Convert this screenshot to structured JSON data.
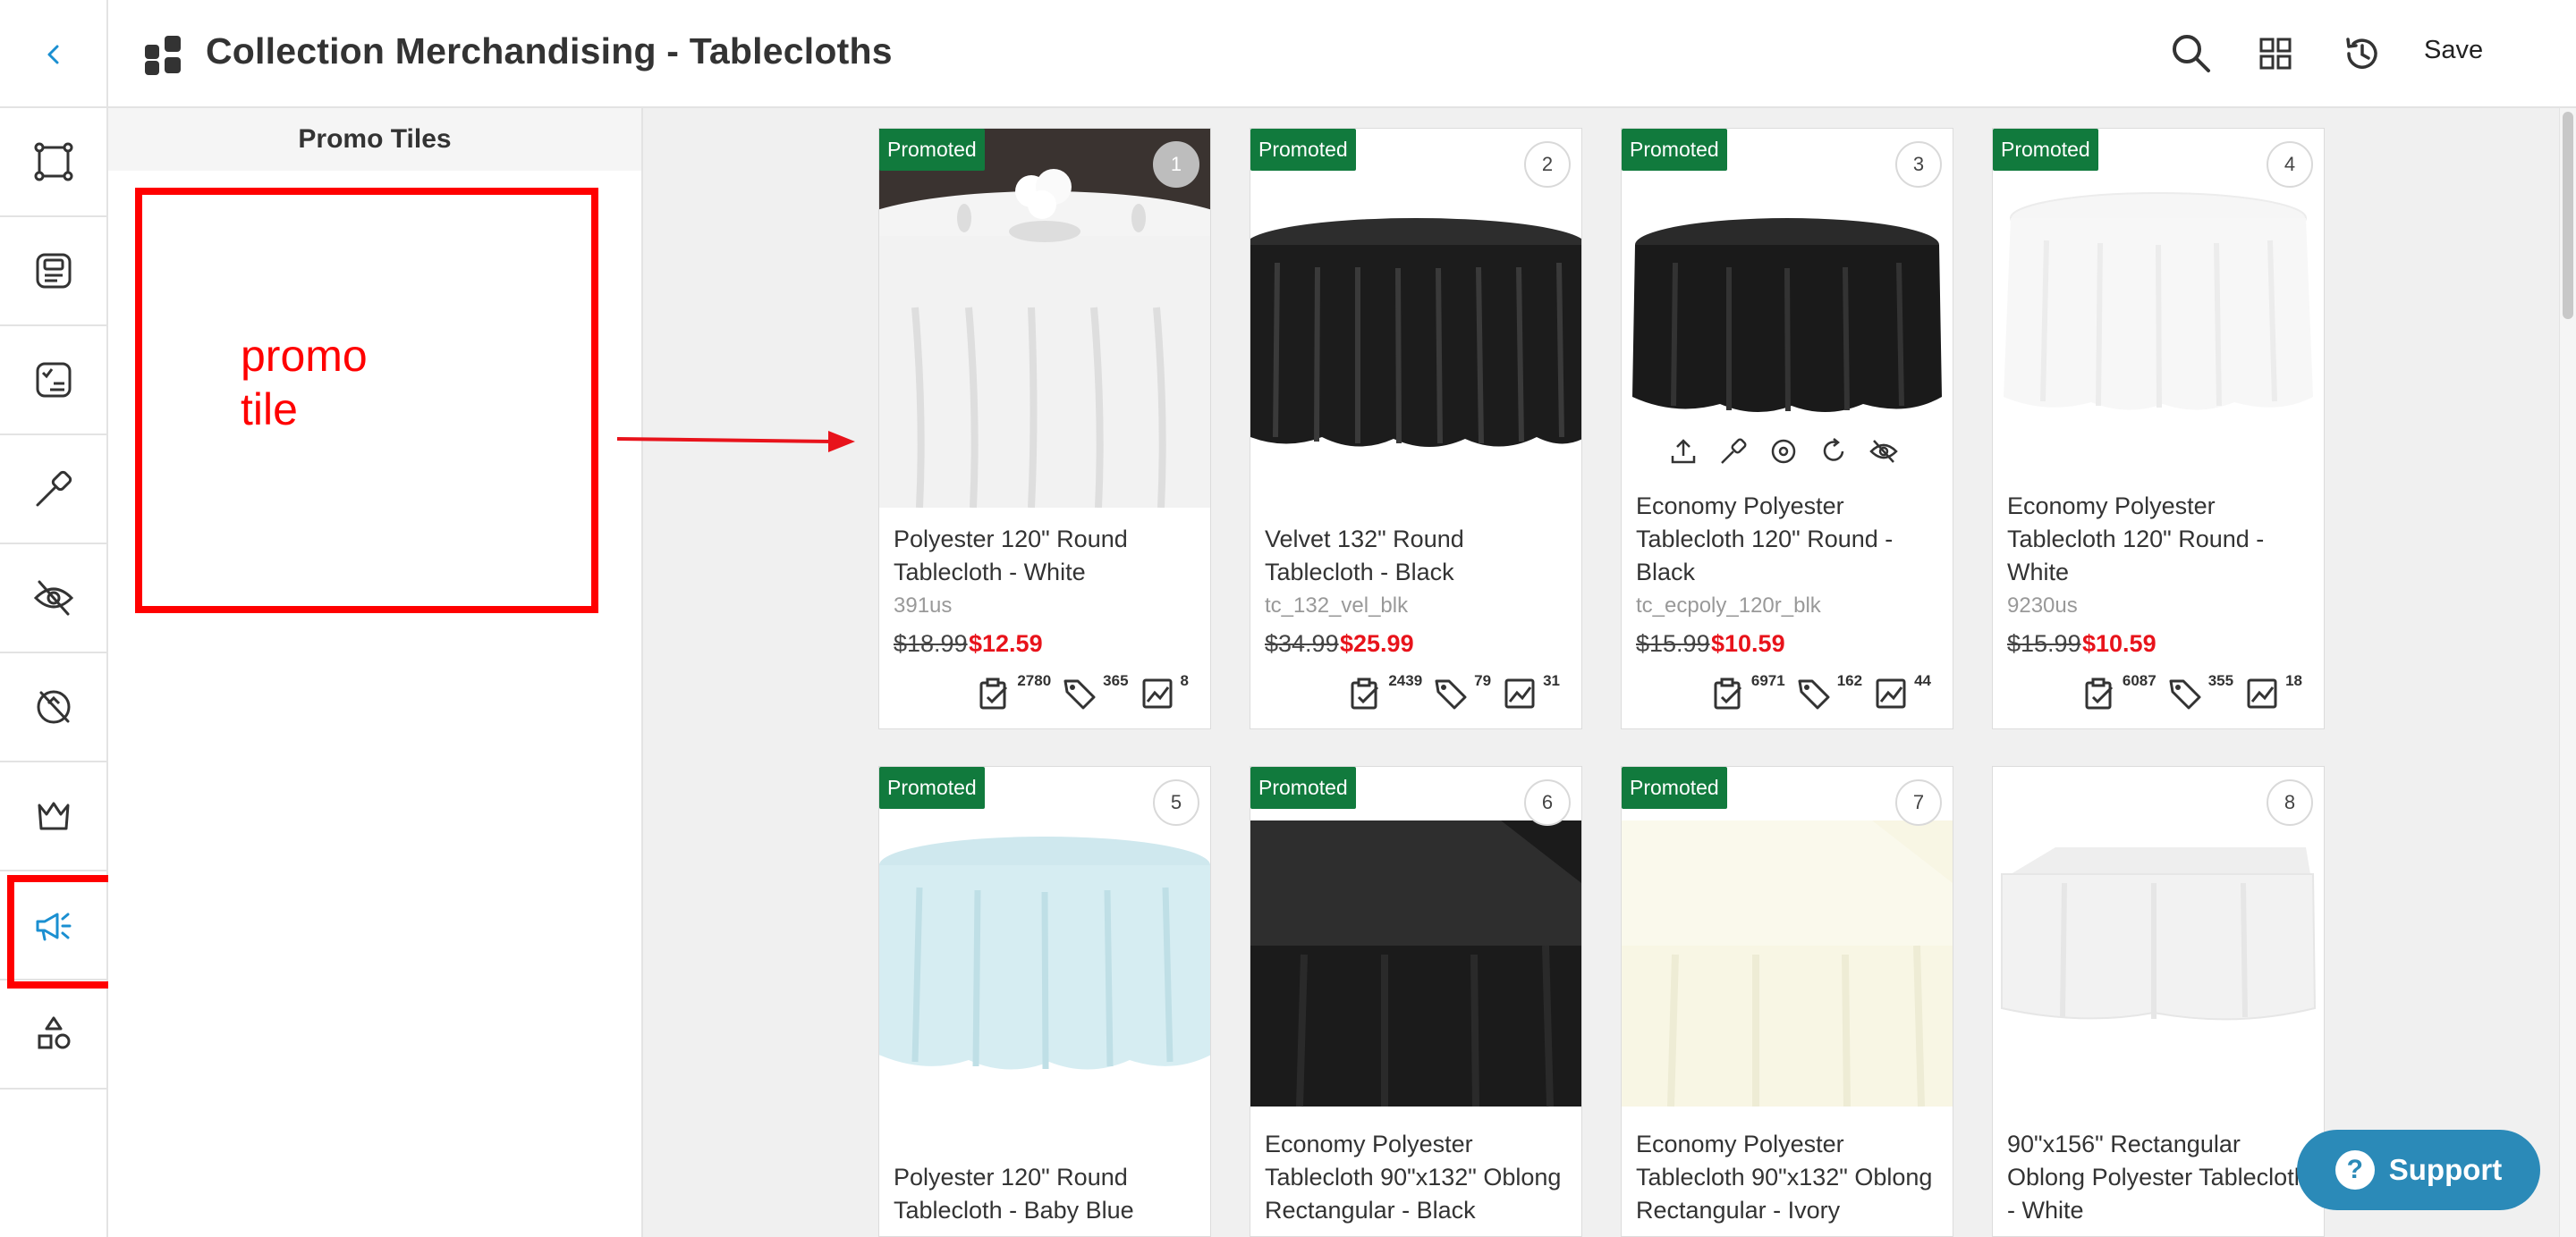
{
  "header": {
    "title": "Collection Merchandising - Tablecloths",
    "save_label": "Save",
    "icons": [
      "search-icon",
      "grid-view-icon",
      "history-icon"
    ]
  },
  "rail": {
    "items": [
      "frame-icon",
      "product-card-icon",
      "rules-icon",
      "pin-icon",
      "hide-icon",
      "exclude-icon",
      "crown-icon",
      "promo-megaphone-icon",
      "shapes-icon"
    ],
    "active": "promo-megaphone-icon",
    "accent": "#1a8fd1"
  },
  "promo": {
    "heading": "Promo Tiles",
    "annotation_line1": "promo",
    "annotation_line2": "tile"
  },
  "colors": {
    "promoted": "#117a3d",
    "sale": "#e8131b",
    "annotation": "#ff0000"
  },
  "products": [
    {
      "badge": "Promoted",
      "position": "1",
      "name_line1": "Polyester 120\" Round",
      "name_line2": "Tablecloth - White",
      "name_line3": "",
      "sku": "391us",
      "price_old": "$18.99",
      "price_new": "$12.59",
      "stat1": "2780",
      "stat2": "365",
      "stat3": "8"
    },
    {
      "badge": "Promoted",
      "position": "2",
      "name_line1": "Velvet 132\" Round",
      "name_line2": "Tablecloth - Black",
      "name_line3": "",
      "sku": "tc_132_vel_blk",
      "price_old": "$34.99",
      "price_new": "$25.99",
      "stat1": "2439",
      "stat2": "79",
      "stat3": "31"
    },
    {
      "badge": "Promoted",
      "position": "3",
      "name_line1": "Economy Polyester",
      "name_line2": "Tablecloth 120\" Round -",
      "name_line3": "Black",
      "sku": "tc_ecpoly_120r_blk",
      "price_old": "$15.99",
      "price_new": "$10.59",
      "stat1": "6971",
      "stat2": "162",
      "stat3": "44"
    },
    {
      "badge": "Promoted",
      "position": "4",
      "name_line1": "Economy Polyester",
      "name_line2": "Tablecloth 120\" Round -",
      "name_line3": "White",
      "sku": "9230us",
      "price_old": "$15.99",
      "price_new": "$10.59",
      "stat1": "6087",
      "stat2": "355",
      "stat3": "18"
    },
    {
      "badge": "Promoted",
      "position": "5",
      "name_line1": "Polyester 120\" Round",
      "name_line2": "Tablecloth - Baby Blue",
      "name_line3": ""
    },
    {
      "badge": "Promoted",
      "position": "6",
      "name_line1": "Economy Polyester",
      "name_line2": "Tablecloth 90\"x132\" Oblong",
      "name_line3": "Rectangular - Black"
    },
    {
      "badge": "Promoted",
      "position": "7",
      "name_line1": "Economy Polyester",
      "name_line2": "Tablecloth 90\"x132\" Oblong",
      "name_line3": "Rectangular - Ivory"
    },
    {
      "badge": "",
      "position": "8",
      "name_line1": "90\"x156\" Rectangular",
      "name_line2": "Oblong Polyester Tablecloth",
      "name_line3": "- White"
    }
  ],
  "support": {
    "label": "Support"
  }
}
